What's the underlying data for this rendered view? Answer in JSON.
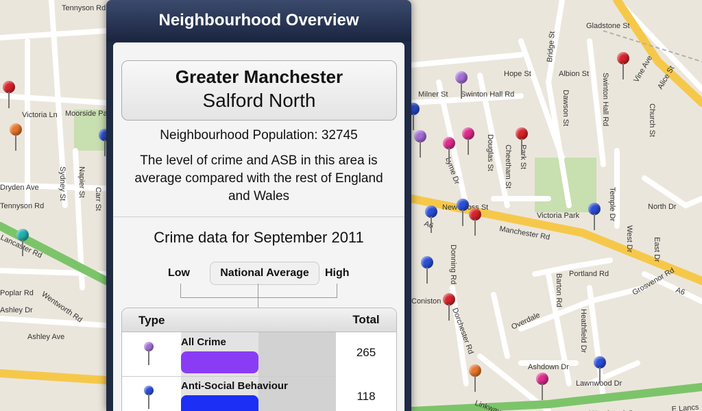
{
  "map": {
    "street_labels": [
      "Tennyson Rd",
      "Moorside Park",
      "Victoria Ln",
      "Sydney St",
      "Napier St",
      "Carr St",
      "Dryden Ave",
      "Tennyson Rd",
      "Lancaster Rd",
      "Wentworth Rd",
      "Poplar Rd",
      "Ashley Dr",
      "Ashley Ave",
      "Hope St",
      "Albion St",
      "Milner St",
      "Swinton Hall Rd",
      "Dawson St",
      "Swinton Hall Rd",
      "Vine Ave",
      "Alice St",
      "Church St",
      "Gladstone St",
      "Bridge St",
      "Douglas St",
      "Cheetham St",
      "Park St",
      "Lyme Dr",
      "Victoria Park",
      "Temple Dr",
      "North Dr",
      "New Cross St",
      "A6",
      "Manchester Rd",
      "West Dr",
      "East Dr",
      "Portland Rd",
      "Grosvenor Rd",
      "A6",
      "Donning Rd",
      "Coniston",
      "Dorchester Rd",
      "Barton Rd",
      "Overdale",
      "Heathfield Dr",
      "Ashdown Dr",
      "Lawnwood Dr",
      "Linkway",
      "Woodstock Dr",
      "E Lancs"
    ],
    "pins": [
      {
        "color": "#d8232a"
      },
      {
        "color": "#e8762a"
      },
      {
        "color": "#2a4fd8"
      },
      {
        "color": "#23b0b0"
      },
      {
        "color": "#a56ed8"
      },
      {
        "color": "#2a4fd8"
      },
      {
        "color": "#a56ed8"
      },
      {
        "color": "#e02a8c"
      },
      {
        "color": "#e02a8c"
      },
      {
        "color": "#d8232a"
      },
      {
        "color": "#d8232a"
      },
      {
        "color": "#2a4fd8"
      },
      {
        "color": "#2a4fd8"
      },
      {
        "color": "#d8232a"
      },
      {
        "color": "#2a4fd8"
      },
      {
        "color": "#2a4fd8"
      },
      {
        "color": "#d8232a"
      },
      {
        "color": "#e8762a"
      },
      {
        "color": "#e02a8c"
      },
      {
        "color": "#2a4fd8"
      }
    ]
  },
  "panel": {
    "title": "Neighbourhood Overview",
    "area": {
      "region": "Greater Manchester",
      "name": "Salford North"
    },
    "population_text": "Neighbourhood Population: 32745",
    "crime_level_text": "The level of crime and ASB in this area is average compared with the rest of England and Wales",
    "crime_heading": "Crime data for September 2011",
    "scale": {
      "low": "Low",
      "average": "National Average",
      "high": "High"
    },
    "table": {
      "header_type": "Type",
      "header_total": "Total",
      "rows": [
        {
          "label": "All Crime",
          "total": "265",
          "color": "#8a3cf5",
          "pin_color": "#a56ed8",
          "level": 0.5
        },
        {
          "label": "Anti-Social Behaviour",
          "total": "118",
          "color": "#1b2ff5",
          "pin_color": "#2a4fd8",
          "level": 0.5
        }
      ]
    }
  }
}
